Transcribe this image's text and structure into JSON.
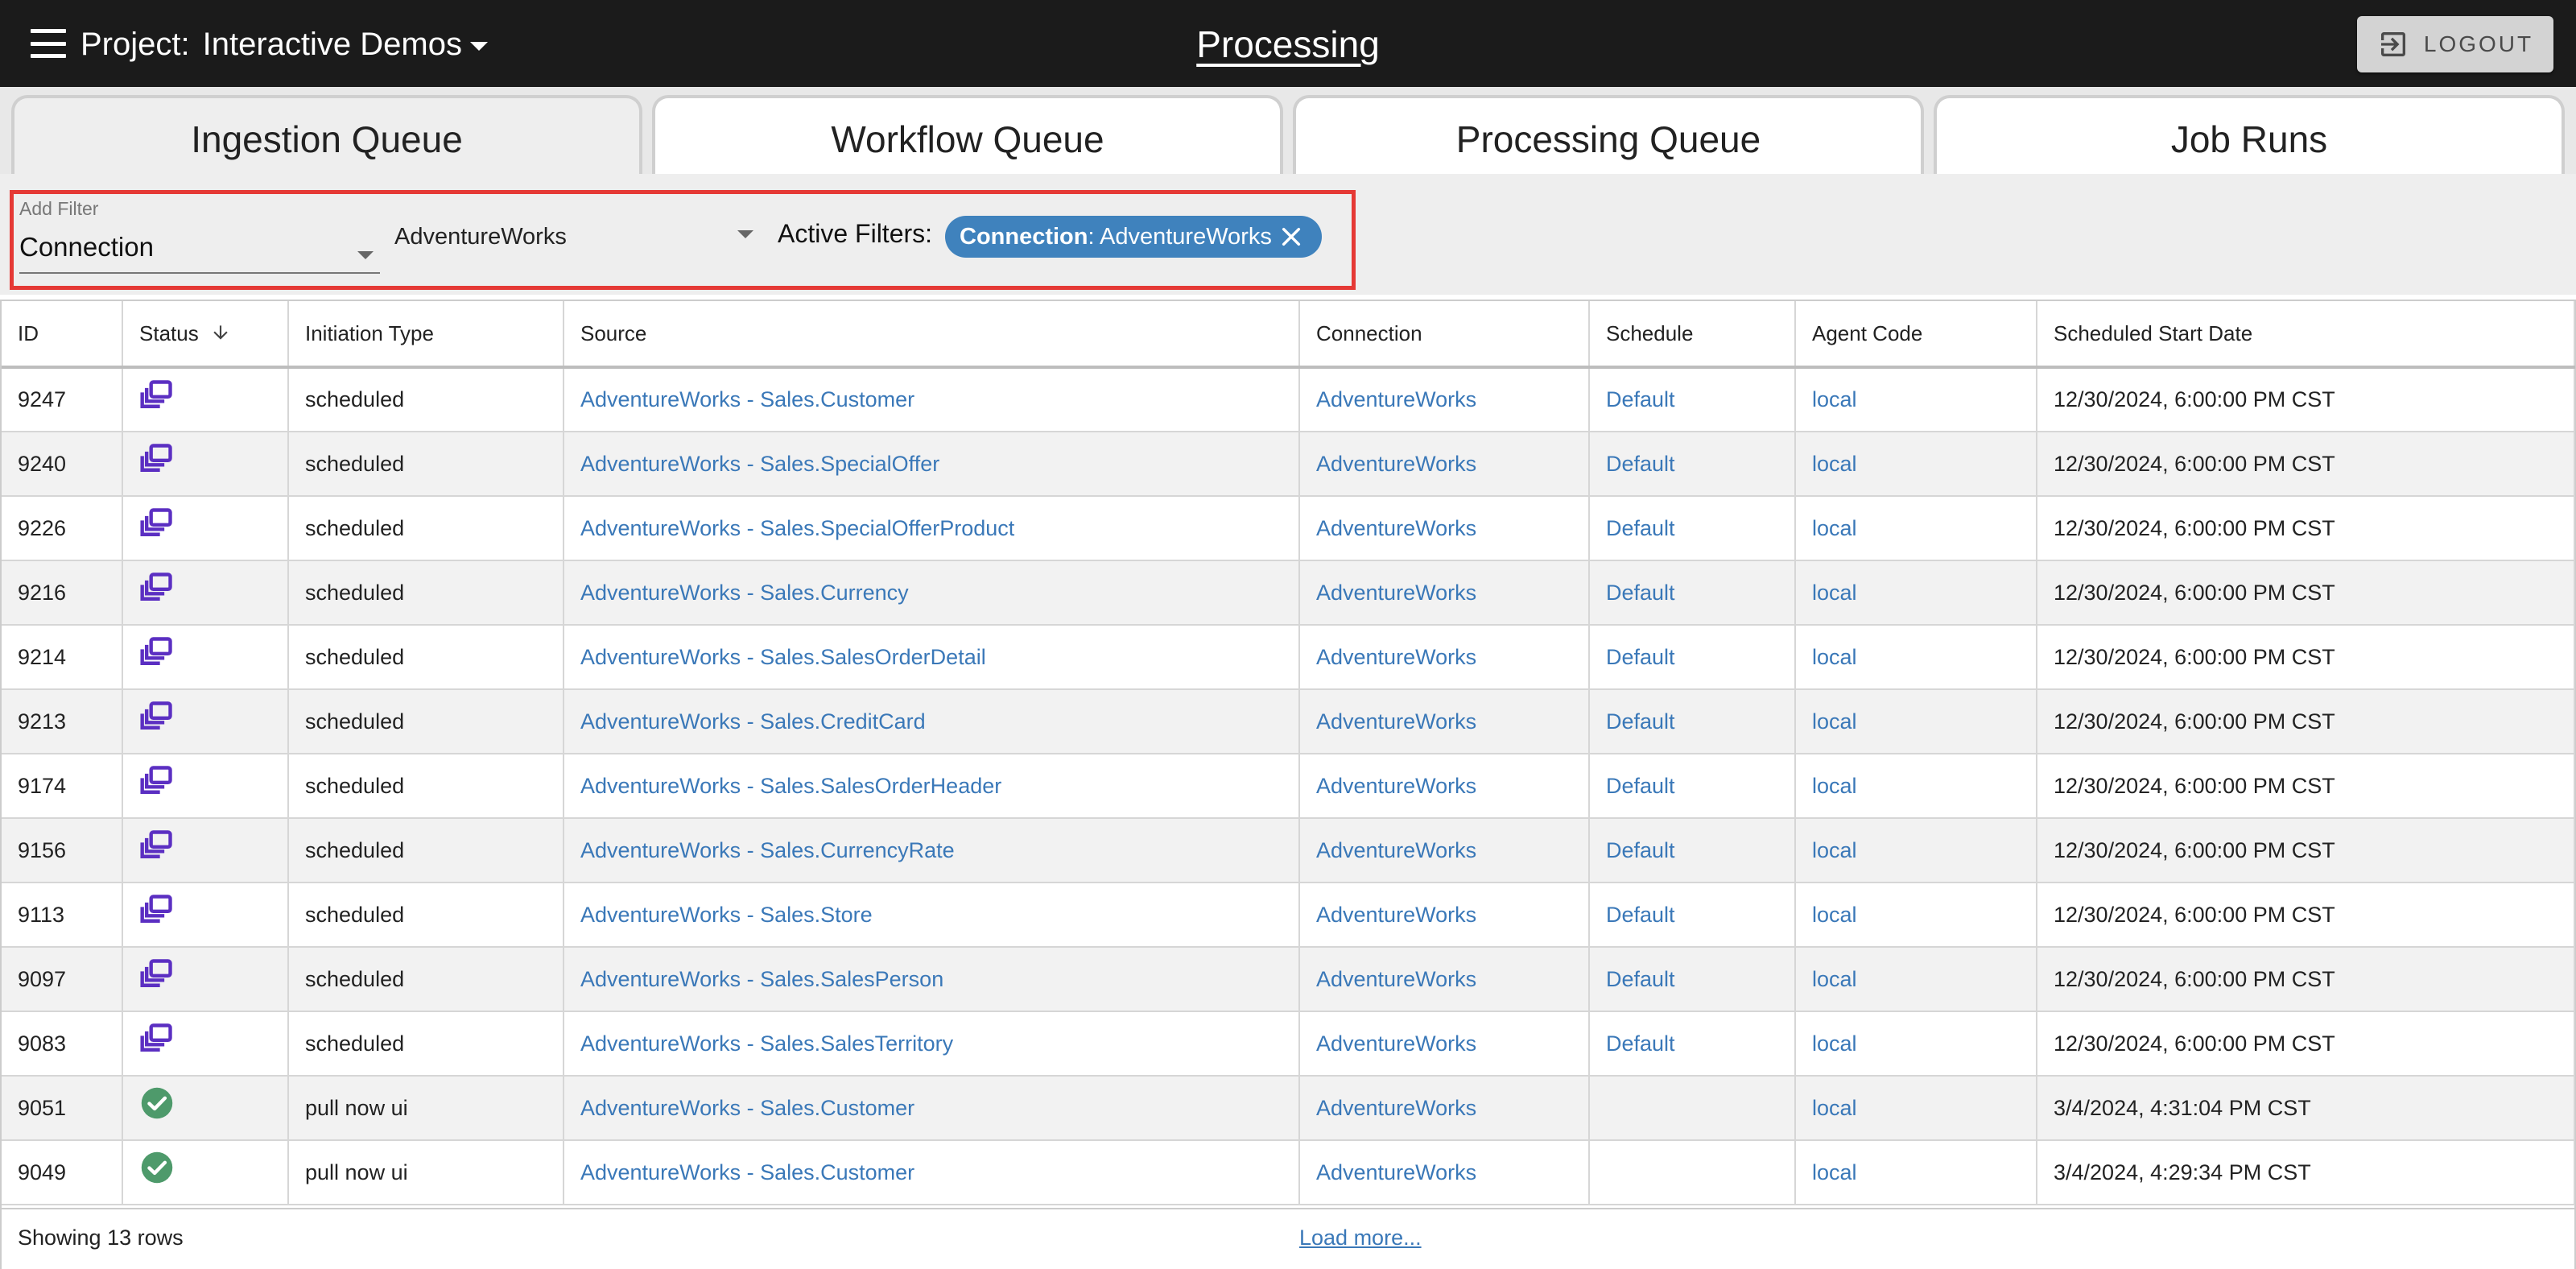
{
  "header": {
    "project_label": "Project:",
    "project_name": "Interactive Demos",
    "title": "Processing",
    "logout_label": "LOGOUT"
  },
  "tabs": [
    {
      "label": "Ingestion Queue",
      "active": true
    },
    {
      "label": "Workflow Queue",
      "active": false
    },
    {
      "label": "Processing Queue",
      "active": false
    },
    {
      "label": "Job Runs",
      "active": false
    }
  ],
  "filter": {
    "add_filter_label": "Add Filter",
    "field_value": "Connection",
    "value_value": "AdventureWorks",
    "active_filters_label": "Active Filters:",
    "chip_key": "Connection",
    "chip_value": ": AdventureWorks"
  },
  "table": {
    "columns": [
      "ID",
      "Status",
      "Initiation Type",
      "Source",
      "Connection",
      "Schedule",
      "Agent Code",
      "Scheduled Start Date"
    ],
    "rows": [
      {
        "id": "9247",
        "status": "queued",
        "initiation": "scheduled",
        "source": "AdventureWorks - Sales.Customer",
        "connection": "AdventureWorks",
        "schedule": "Default",
        "agent": "local",
        "start": "12/30/2024, 6:00:00 PM CST"
      },
      {
        "id": "9240",
        "status": "queued",
        "initiation": "scheduled",
        "source": "AdventureWorks - Sales.SpecialOffer",
        "connection": "AdventureWorks",
        "schedule": "Default",
        "agent": "local",
        "start": "12/30/2024, 6:00:00 PM CST"
      },
      {
        "id": "9226",
        "status": "queued",
        "initiation": "scheduled",
        "source": "AdventureWorks - Sales.SpecialOfferProduct",
        "connection": "AdventureWorks",
        "schedule": "Default",
        "agent": "local",
        "start": "12/30/2024, 6:00:00 PM CST"
      },
      {
        "id": "9216",
        "status": "queued",
        "initiation": "scheduled",
        "source": "AdventureWorks - Sales.Currency",
        "connection": "AdventureWorks",
        "schedule": "Default",
        "agent": "local",
        "start": "12/30/2024, 6:00:00 PM CST"
      },
      {
        "id": "9214",
        "status": "queued",
        "initiation": "scheduled",
        "source": "AdventureWorks - Sales.SalesOrderDetail",
        "connection": "AdventureWorks",
        "schedule": "Default",
        "agent": "local",
        "start": "12/30/2024, 6:00:00 PM CST"
      },
      {
        "id": "9213",
        "status": "queued",
        "initiation": "scheduled",
        "source": "AdventureWorks - Sales.CreditCard",
        "connection": "AdventureWorks",
        "schedule": "Default",
        "agent": "local",
        "start": "12/30/2024, 6:00:00 PM CST"
      },
      {
        "id": "9174",
        "status": "queued",
        "initiation": "scheduled",
        "source": "AdventureWorks - Sales.SalesOrderHeader",
        "connection": "AdventureWorks",
        "schedule": "Default",
        "agent": "local",
        "start": "12/30/2024, 6:00:00 PM CST"
      },
      {
        "id": "9156",
        "status": "queued",
        "initiation": "scheduled",
        "source": "AdventureWorks - Sales.CurrencyRate",
        "connection": "AdventureWorks",
        "schedule": "Default",
        "agent": "local",
        "start": "12/30/2024, 6:00:00 PM CST"
      },
      {
        "id": "9113",
        "status": "queued",
        "initiation": "scheduled",
        "source": "AdventureWorks - Sales.Store",
        "connection": "AdventureWorks",
        "schedule": "Default",
        "agent": "local",
        "start": "12/30/2024, 6:00:00 PM CST"
      },
      {
        "id": "9097",
        "status": "queued",
        "initiation": "scheduled",
        "source": "AdventureWorks - Sales.SalesPerson",
        "connection": "AdventureWorks",
        "schedule": "Default",
        "agent": "local",
        "start": "12/30/2024, 6:00:00 PM CST"
      },
      {
        "id": "9083",
        "status": "queued",
        "initiation": "scheduled",
        "source": "AdventureWorks - Sales.SalesTerritory",
        "connection": "AdventureWorks",
        "schedule": "Default",
        "agent": "local",
        "start": "12/30/2024, 6:00:00 PM CST"
      },
      {
        "id": "9051",
        "status": "complete",
        "initiation": "pull now ui",
        "source": "AdventureWorks - Sales.Customer",
        "connection": "AdventureWorks",
        "schedule": "",
        "agent": "local",
        "start": "3/4/2024, 4:31:04 PM CST"
      },
      {
        "id": "9049",
        "status": "complete",
        "initiation": "pull now ui",
        "source": "AdventureWorks - Sales.Customer",
        "connection": "AdventureWorks",
        "schedule": "",
        "agent": "local",
        "start": "3/4/2024, 4:29:34 PM CST"
      }
    ]
  },
  "footer": {
    "count_text": "Showing 13 rows",
    "load_more": "Load more..."
  },
  "icons": {
    "queued": "queue-stack-icon",
    "complete": "check-circle-icon"
  },
  "colors": {
    "topbar": "#1b1b1b",
    "link": "#3a78b8",
    "chip": "#3f82bd",
    "queued_icon": "#5b2fc2",
    "complete_icon": "#4e9a6b",
    "highlight_box": "#e53935"
  }
}
